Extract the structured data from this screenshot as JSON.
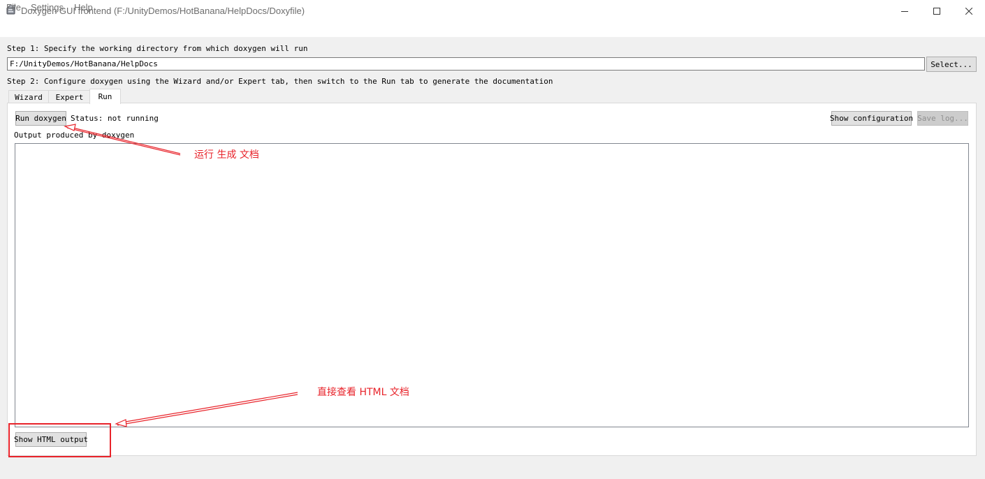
{
  "window": {
    "title": "Doxygen GUI frontend (F:/UnityDemos/HotBanana/HelpDocs/Doxyfile)",
    "icon": "doxygen-app-icon",
    "controls": [
      "minimize-icon",
      "maximize-icon",
      "close-icon"
    ]
  },
  "menu": {
    "file": "File",
    "settings": "Settings",
    "help": "Help"
  },
  "step1": {
    "label": "Step 1: Specify the working directory from which doxygen will run",
    "working_dir": "F:/UnityDemos/HotBanana/HelpDocs",
    "select_label": "Select..."
  },
  "step2": {
    "label": "Step 2: Configure doxygen using the Wizard and/or Expert tab, then switch to the Run tab to generate the documentation"
  },
  "tabs": {
    "wizard": "Wizard",
    "expert": "Expert",
    "run": "Run",
    "active": "Run"
  },
  "run_tab": {
    "run_button": "Run doxygen",
    "status": "Status: not running",
    "show_config_button": "Show configuration",
    "save_log_button": "Save log...",
    "output_label": "Output produced by doxygen",
    "output_text": "",
    "show_html_button": "Show HTML output"
  },
  "annotations": {
    "run_note": "运行 生成 文档",
    "html_note": "直接查看 HTML 文档",
    "color": "#e8232a"
  }
}
